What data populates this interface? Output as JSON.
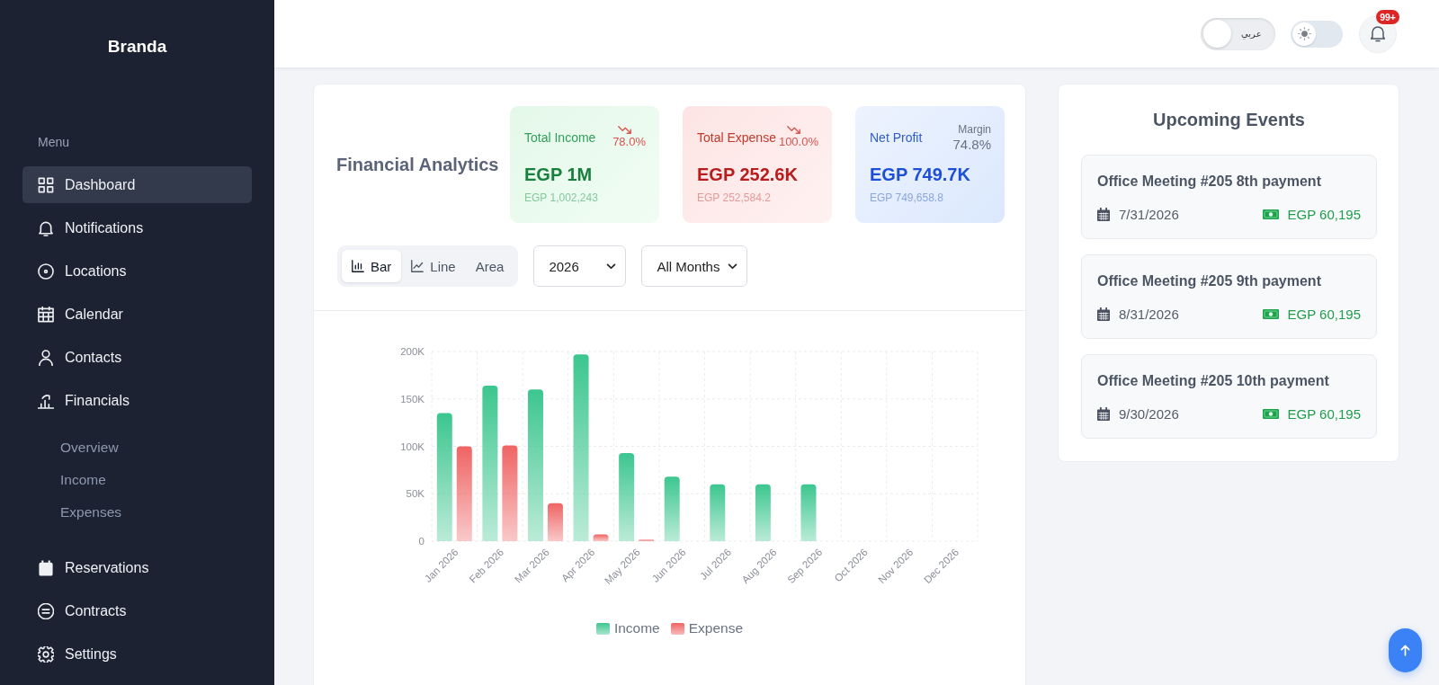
{
  "sidebar": {
    "brand": "Branda",
    "section": "Menu",
    "items": [
      {
        "label": "Dashboard",
        "selected": true
      },
      {
        "label": "Notifications",
        "selected": false
      },
      {
        "label": "Locations",
        "selected": false
      },
      {
        "label": "Calendar",
        "selected": false
      },
      {
        "label": "Contacts",
        "selected": false
      },
      {
        "label": "Financials",
        "selected": false,
        "children": [
          {
            "label": "Overview",
            "selected": false
          },
          {
            "label": "Income",
            "selected": false
          },
          {
            "label": "Expenses",
            "selected": false
          }
        ]
      },
      {
        "label": "Reservations",
        "selected": false
      },
      {
        "label": "Contracts",
        "selected": false
      },
      {
        "label": "Settings",
        "selected": false
      }
    ]
  },
  "topbar": {
    "language_toggle": {
      "label": "عربي",
      "on": false
    },
    "theme_toggle": {
      "on": false
    },
    "notifications": {
      "badge": "99+"
    }
  },
  "financial_analytics": {
    "title": "Financial Analytics",
    "stats": [
      {
        "kind": "income",
        "label": "Total Income",
        "declining": true,
        "change": "78.0%",
        "value": "EGP 1M",
        "exact": "EGP 1,002,243"
      },
      {
        "kind": "expense",
        "label": "Total Expense",
        "declining": true,
        "change": "100.0%",
        "value": "EGP 252.6K",
        "exact": "EGP 252,584.2"
      },
      {
        "kind": "profit",
        "label": "Net Profit",
        "caption": "Margin",
        "change": "74.8%",
        "value": "EGP 749.7K",
        "exact": "EGP 749,658.8"
      }
    ],
    "chart_types": [
      {
        "kind": "bar",
        "label": "Bar",
        "selected": true
      },
      {
        "kind": "line",
        "label": "Line",
        "selected": false
      },
      {
        "kind": "area",
        "label": "Area",
        "selected": false
      }
    ],
    "filters": [
      {
        "value": "2026"
      },
      {
        "value": "All Months"
      }
    ],
    "chart_data": {
      "type": "bar",
      "categories": [
        "Jan 2026",
        "Feb 2026",
        "Mar 2026",
        "Apr 2026",
        "May 2026",
        "Jun 2026",
        "Jul 2026",
        "Aug 2026",
        "Sep 2026",
        "Oct 2026",
        "Nov 2026",
        "Dec 2026"
      ],
      "series": [
        {
          "name": "Income",
          "color": "#3cc68f",
          "values": [
            135000,
            164000,
            160000,
            197000,
            93000,
            68000,
            60000,
            60000,
            60000,
            0,
            0,
            0
          ]
        },
        {
          "name": "Expense",
          "color": "#ef6464",
          "values": [
            100000,
            101000,
            40000,
            7000,
            1000,
            0,
            0,
            0,
            0,
            0,
            0,
            0
          ]
        }
      ],
      "ylim": [
        0,
        200000
      ],
      "yticks": [
        {
          "value": 0,
          "label": "0"
        },
        {
          "value": 50000,
          "label": "50K"
        },
        {
          "value": 100000,
          "label": "100K"
        },
        {
          "value": 150000,
          "label": "150K"
        },
        {
          "value": 200000,
          "label": "200K"
        }
      ],
      "grid": true,
      "legend": true
    }
  },
  "upcoming_events": {
    "title": "Upcoming Events",
    "events": [
      {
        "title": "Office Meeting #205 8th payment",
        "date": "7/31/2026",
        "amount": "EGP 60,195"
      },
      {
        "title": "Office Meeting #205 9th payment",
        "date": "8/31/2026",
        "amount": "EGP 60,195"
      },
      {
        "title": "Office Meeting #205 10th payment",
        "date": "9/30/2026",
        "amount": "EGP 60,195"
      }
    ]
  }
}
